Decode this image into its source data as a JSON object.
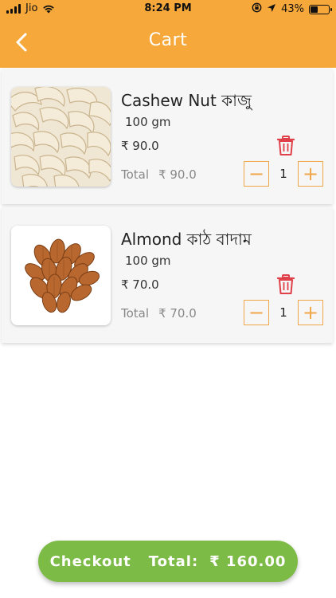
{
  "status_bar": {
    "carrier": "Jio",
    "time": "8:24 PM",
    "battery_percent": "43%",
    "battery_level": 0.43
  },
  "header": {
    "title": "Cart",
    "back_icon": "chevron-left-icon",
    "background_color": "#f7a83a"
  },
  "items": [
    {
      "name": "Cashew Nut কাজু",
      "quantity_label": "100 gm",
      "price": "₹ 90.0",
      "total_label": "Total",
      "total_value": "₹ 90.0",
      "count": "1",
      "minus_label": "−",
      "plus_label": "+",
      "image": "cashew-nuts-image"
    },
    {
      "name": "Almond কাঠ বাদাম",
      "quantity_label": "100 gm",
      "price": "₹ 70.0",
      "total_label": "Total",
      "total_value": "₹ 70.0",
      "count": "1",
      "minus_label": "−",
      "plus_label": "+",
      "image": "almonds-image"
    }
  ],
  "checkout": {
    "label": "Checkout",
    "total_label": "Total:",
    "total_amount": "₹ 160.00",
    "color": "#7dbb47"
  },
  "colors": {
    "accent": "#f0a74a",
    "delete": "#e0404a"
  }
}
